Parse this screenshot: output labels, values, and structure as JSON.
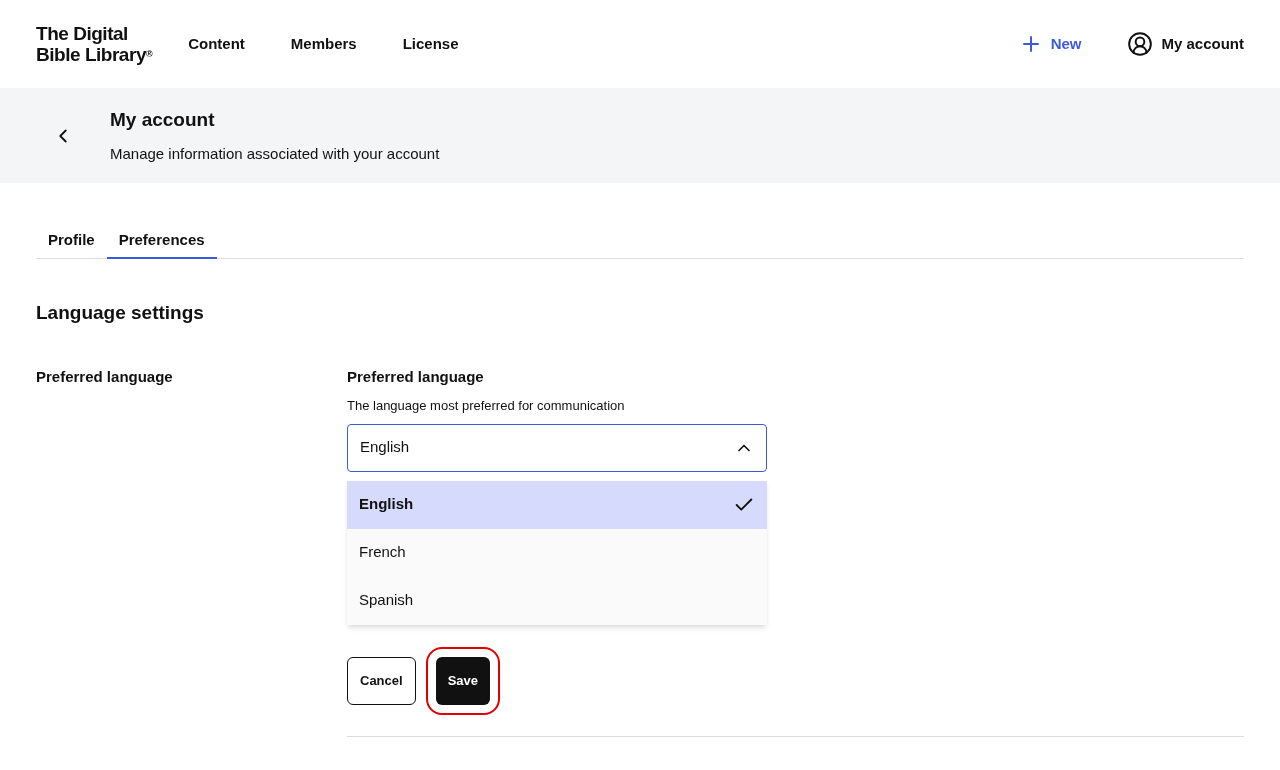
{
  "header": {
    "logo_line_1": "The Digital",
    "logo_line_2": "Bible Library",
    "logo_mark": "®",
    "nav": [
      {
        "label": "Content"
      },
      {
        "label": "Members"
      },
      {
        "label": "License"
      }
    ],
    "new_button": "New",
    "account_button": "My account"
  },
  "page_header": {
    "title": "My account",
    "subtitle": "Manage information associated with your account"
  },
  "tabs": [
    {
      "label": "Profile",
      "selected": false
    },
    {
      "label": "Preferences",
      "selected": true
    }
  ],
  "section_title": "Language settings",
  "setting": {
    "label": "Preferred language",
    "field_label": "Preferred language",
    "field_help": "The language most preferred for communication",
    "value": "English",
    "expanded": true,
    "options": [
      {
        "label": "English",
        "selected": true
      },
      {
        "label": "French",
        "selected": false
      },
      {
        "label": "Spanish",
        "selected": false
      }
    ]
  },
  "buttons": [
    {
      "label": "Cancel",
      "kind": "secondary",
      "highlighted": false
    },
    {
      "label": "Save",
      "kind": "primary",
      "highlighted": true
    }
  ]
}
